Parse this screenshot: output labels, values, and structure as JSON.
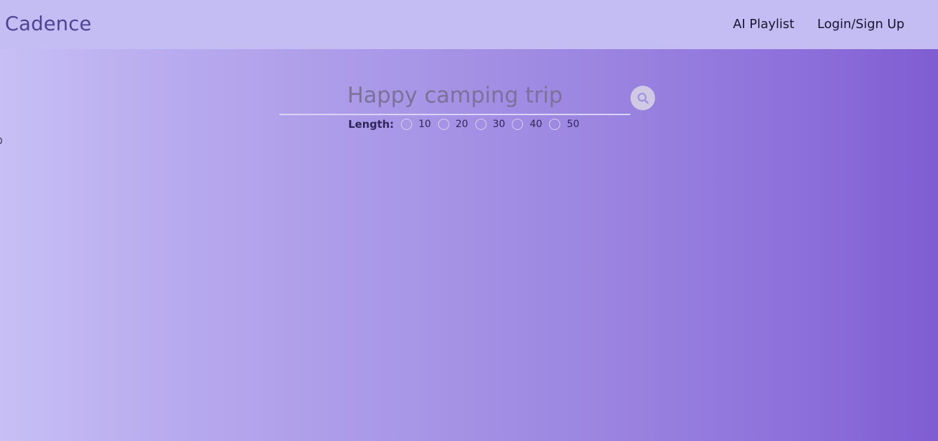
{
  "header": {
    "brand": "Cadence",
    "nav": {
      "ai_playlist": "AI Playlist",
      "login_signup": "Login/Sign Up"
    }
  },
  "edge_text": "0",
  "search": {
    "placeholder": "Happy camping trip",
    "value": "",
    "icon": "search-icon"
  },
  "length": {
    "label": "Length:",
    "options": [
      "10",
      "20",
      "30",
      "40",
      "50"
    ],
    "selected": null
  },
  "colors": {
    "navbar": "#c4bdf3",
    "brand": "#4e4494",
    "gradient_start": "#c7bff5",
    "gradient_end": "#7f5dd2",
    "search_button": "#cfc9e4"
  }
}
